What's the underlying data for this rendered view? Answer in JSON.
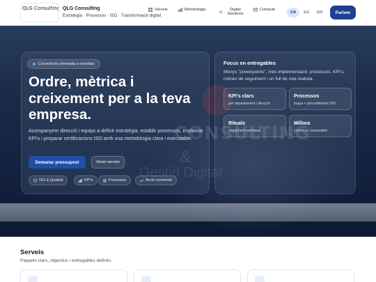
{
  "header": {
    "logo_alt": "QLG Consulting",
    "brand": "QLG Consulting",
    "tagline": "Estratègia · Processos · ISO · Transformació digital",
    "nav": [
      {
        "label": "Serveis",
        "icon": "grid-icon"
      },
      {
        "label": "Metodologia",
        "icon": "chart-icon"
      },
      {
        "label": "Digital Solutions",
        "icon": "spark-icon"
      },
      {
        "label": "Contacte",
        "icon": "mail-icon"
      }
    ],
    "languages": [
      "CA",
      "ES",
      "EN"
    ],
    "active_language": "CA",
    "cta": "Parlem"
  },
  "hero": {
    "badge": "Consultoria orientada a resultats",
    "headline": "Ordre, mètrica i creixement per a la teva empresa.",
    "description": "Acompanyem direcció i equips a definir estratègia, establir processos, implantar KPI's i preparar certificacions ISO amb una metodologia clara i executable.",
    "primary_button": "Demanar pressupost",
    "secondary_button": "Veure serveis",
    "chips": [
      {
        "label": "ISO & Qualitat",
        "icon": "shield-icon"
      },
      {
        "label": "KPI's",
        "icon": "bar-chart-icon"
      },
      {
        "label": "Processos",
        "icon": "list-icon"
      },
      {
        "label": "Acció comercial",
        "icon": "trend-icon"
      }
    ],
    "watermark": {
      "line1": "CONSULTING",
      "line2": "&",
      "line3": "Gestió Digital"
    }
  },
  "focus": {
    "title": "Focus en entregables",
    "description": "Menys \"powerpoints\", més implementació: processos, KPI's, rutines de seguiment i un full de ruta realista.",
    "boxes": [
      {
        "title": "KPI's clars",
        "subtitle": "per departament i direcció"
      },
      {
        "title": "Processos",
        "subtitle": "mapa + procediments ISO"
      },
      {
        "title": "Rituals",
        "subtitle": "seguiment setmanal"
      },
      {
        "title": "Millora",
        "subtitle": "contínua i mesurable"
      }
    ]
  },
  "services": {
    "title": "Serveis",
    "subtitle": "Paquets clars, objectius i entregables definits."
  },
  "colors": {
    "accent": "#1f4fa8",
    "header_cta": "#1f3f8f",
    "hero_dark": "#132240",
    "badge_dot": "#5fa8ff"
  }
}
